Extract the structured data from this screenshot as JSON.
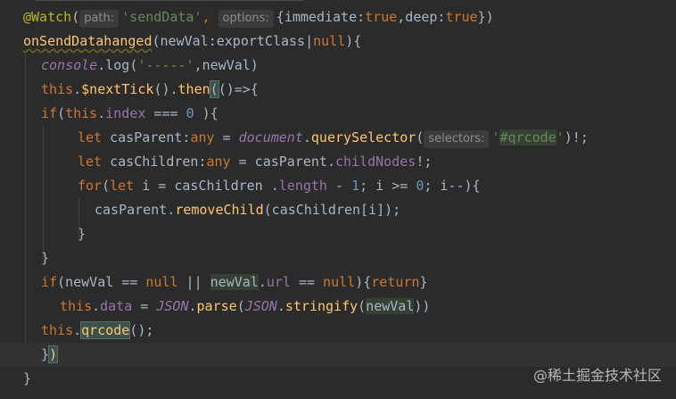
{
  "editor": {
    "lines": [
      {
        "indent": 26,
        "tokens": [
          {
            "t": "@Watch",
            "c": "ann"
          },
          {
            "t": "(",
            "c": "plain"
          },
          {
            "t": "path:",
            "c": "hint"
          },
          {
            "t": "'sendData'",
            "c": "str"
          },
          {
            "t": ", ",
            "c": "kw"
          },
          {
            "t": "options:",
            "c": "hint"
          },
          {
            "t": "{immediate:",
            "c": "plain"
          },
          {
            "t": "true",
            "c": "kw"
          },
          {
            "t": ",deep:",
            "c": "plain"
          },
          {
            "t": "true",
            "c": "kw"
          },
          {
            "t": "})",
            "c": "plain"
          }
        ]
      },
      {
        "indent": 26,
        "tokens": [
          {
            "t": "onSendDatahanged",
            "c": "fn wavy"
          },
          {
            "t": "(newVal:exportClass|",
            "c": "plain"
          },
          {
            "t": "null",
            "c": "kw"
          },
          {
            "t": "){",
            "c": "plain"
          }
        ]
      },
      {
        "indent": 46,
        "tokens": [
          {
            "t": "console",
            "c": "prop it"
          },
          {
            "t": ".log(",
            "c": "plain"
          },
          {
            "t": "'-----'",
            "c": "str"
          },
          {
            "t": ",newVal)",
            "c": "plain"
          }
        ]
      },
      {
        "indent": 46,
        "tokens": [
          {
            "t": "this",
            "c": "kw"
          },
          {
            "t": ".",
            "c": "plain"
          },
          {
            "t": "$nextTick",
            "c": "fn"
          },
          {
            "t": "().",
            "c": "plain"
          },
          {
            "t": "then",
            "c": "fn"
          },
          {
            "t": "(",
            "c": "caret"
          },
          {
            "t": "()=>{",
            "c": "plain"
          }
        ]
      },
      {
        "indent": 46,
        "tokens": [
          {
            "t": "if",
            "c": "kw"
          },
          {
            "t": "(",
            "c": "plain"
          },
          {
            "t": "this",
            "c": "kw"
          },
          {
            "t": ".",
            "c": "plain"
          },
          {
            "t": "index",
            "c": "prop"
          },
          {
            "t": " === ",
            "c": "plain"
          },
          {
            "t": "0",
            "c": "num"
          },
          {
            "t": " ){",
            "c": "plain"
          }
        ]
      },
      {
        "indent": 87,
        "tokens": [
          {
            "t": "let",
            "c": "kw"
          },
          {
            "t": " casParent:",
            "c": "plain"
          },
          {
            "t": "any",
            "c": "kw"
          },
          {
            "t": " = ",
            "c": "plain"
          },
          {
            "t": "document",
            "c": "prop it"
          },
          {
            "t": ".",
            "c": "plain"
          },
          {
            "t": "querySelector",
            "c": "fn"
          },
          {
            "t": "(",
            "c": "plain"
          },
          {
            "t": "selectors:",
            "c": "hint"
          },
          {
            "t": "'",
            "c": "str"
          },
          {
            "t": "#qrcode",
            "c": "str hl"
          },
          {
            "t": "'",
            "c": "str"
          },
          {
            "t": ")!;",
            "c": "plain"
          }
        ]
      },
      {
        "indent": 87,
        "tokens": [
          {
            "t": "let",
            "c": "kw"
          },
          {
            "t": " casChildren:",
            "c": "plain"
          },
          {
            "t": "any",
            "c": "kw"
          },
          {
            "t": " = casParent.",
            "c": "plain"
          },
          {
            "t": "childNodes",
            "c": "prop"
          },
          {
            "t": "!;",
            "c": "plain"
          }
        ]
      },
      {
        "indent": 87,
        "tokens": [
          {
            "t": "for",
            "c": "kw"
          },
          {
            "t": "(",
            "c": "plain"
          },
          {
            "t": "let",
            "c": "kw"
          },
          {
            "t": " i = casChildren .",
            "c": "plain"
          },
          {
            "t": "length",
            "c": "prop"
          },
          {
            "t": " - ",
            "c": "plain"
          },
          {
            "t": "1",
            "c": "num"
          },
          {
            "t": "; i >= ",
            "c": "plain"
          },
          {
            "t": "0",
            "c": "num"
          },
          {
            "t": "; i--){",
            "c": "plain"
          }
        ]
      },
      {
        "indent": 106,
        "tokens": [
          {
            "t": "casParent.",
            "c": "plain"
          },
          {
            "t": "removeChild",
            "c": "fn"
          },
          {
            "t": "(casChildren[i]);",
            "c": "plain"
          }
        ]
      },
      {
        "indent": 87,
        "tokens": [
          {
            "t": "}",
            "c": "plain"
          }
        ]
      },
      {
        "indent": 46,
        "tokens": [
          {
            "t": "}",
            "c": "plain"
          }
        ]
      },
      {
        "indent": 46,
        "tokens": [
          {
            "t": "if",
            "c": "kw"
          },
          {
            "t": "(newVal == ",
            "c": "plain"
          },
          {
            "t": "null",
            "c": "kw"
          },
          {
            "t": " || ",
            "c": "plain"
          },
          {
            "t": "newVal",
            "c": "plain hl"
          },
          {
            "t": ".",
            "c": "plain"
          },
          {
            "t": "url",
            "c": "prop"
          },
          {
            "t": " == ",
            "c": "plain"
          },
          {
            "t": "null",
            "c": "kw"
          },
          {
            "t": "){",
            "c": "plain"
          },
          {
            "t": "return",
            "c": "kw"
          },
          {
            "t": "}",
            "c": "plain"
          }
        ]
      },
      {
        "indent": 67,
        "tokens": [
          {
            "t": "this",
            "c": "kw"
          },
          {
            "t": ".",
            "c": "plain"
          },
          {
            "t": "data",
            "c": "prop"
          },
          {
            "t": " = ",
            "c": "plain"
          },
          {
            "t": "JSON",
            "c": "prop it"
          },
          {
            "t": ".",
            "c": "plain"
          },
          {
            "t": "parse",
            "c": "fn"
          },
          {
            "t": "(",
            "c": "plain"
          },
          {
            "t": "JSON",
            "c": "prop it"
          },
          {
            "t": ".",
            "c": "plain"
          },
          {
            "t": "stringify",
            "c": "fn"
          },
          {
            "t": "(",
            "c": "plain"
          },
          {
            "t": "newVal",
            "c": "plain hl"
          },
          {
            "t": "))",
            "c": "plain"
          }
        ]
      },
      {
        "indent": 46,
        "tokens": [
          {
            "t": "this",
            "c": "kw"
          },
          {
            "t": ".",
            "c": "plain"
          },
          {
            "t": "qrcode",
            "c": "fn caret"
          },
          {
            "t": "();",
            "c": "plain"
          }
        ]
      },
      {
        "indent": 46,
        "current": true,
        "tokens": [
          {
            "t": "}",
            "c": "plain"
          },
          {
            "t": ")",
            "c": "fn caret"
          }
        ]
      },
      {
        "indent": 26,
        "tokens": [
          {
            "t": "}",
            "c": "plain"
          }
        ]
      }
    ]
  },
  "watermark": "@稀土掘金技术社区"
}
